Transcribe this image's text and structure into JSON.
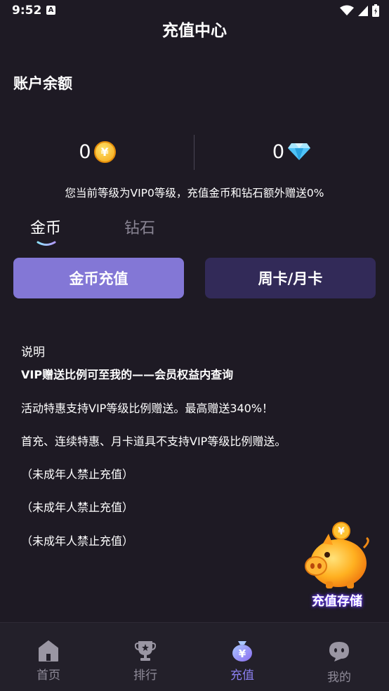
{
  "status_bar": {
    "time": "9:52",
    "notification_icon": "A"
  },
  "header": {
    "title": "充值中心"
  },
  "balance": {
    "section_title": "账户余额",
    "coin_value": "0",
    "coin_icon": "coin-icon",
    "coin_symbol": "¥",
    "diamond_value": "0",
    "diamond_icon": "diamond-icon"
  },
  "vip_note": "您当前等级为VIP0等级，充值金币和钻石额外赠送0%",
  "tabs": [
    {
      "label": "金币",
      "active": true
    },
    {
      "label": "钻石",
      "active": false
    }
  ],
  "buttons": {
    "coin_recharge": "金币充值",
    "week_month_card": "周卡/月卡"
  },
  "description": {
    "title": "说明",
    "lines": [
      "VIP赠送比例可至我的——会员权益内查询",
      "活动特惠支持VIP等级比例赠送。最高赠送340%！",
      "首充、连续特惠、月卡道具不支持VIP等级比例赠送。",
      "（未成年人禁止充值）",
      "（未成年人禁止充值）",
      "（未成年人禁止充值）"
    ]
  },
  "piggy_bank": {
    "label": "充值存储",
    "coin_symbol": "¥"
  },
  "nav": [
    {
      "label": "首页",
      "icon": "home-icon",
      "active": false
    },
    {
      "label": "排行",
      "icon": "trophy-icon",
      "active": false
    },
    {
      "label": "充值",
      "icon": "recharge-bag-icon",
      "active": true,
      "icon_symbol": "¥"
    },
    {
      "label": "我的",
      "icon": "profile-face-icon",
      "active": false
    }
  ],
  "colors": {
    "background": "#1e1a24",
    "accent": "#8b7ff0",
    "primary_button": "#8377d6",
    "secondary_button": "#322a58"
  }
}
